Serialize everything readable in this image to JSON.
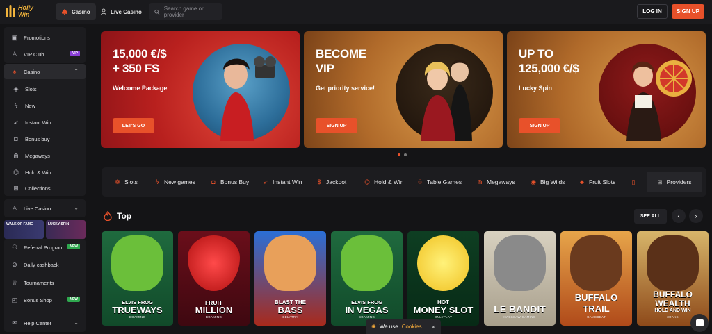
{
  "header": {
    "logo_text_1": "Holly",
    "logo_text_2": "Win",
    "tabs": [
      {
        "label": "Casino",
        "icon": "spade-icon"
      },
      {
        "label": "Live Casino",
        "icon": "dealer-icon"
      }
    ],
    "search_placeholder": "Search game or provider",
    "login_label": "LOG IN",
    "signup_label": "SIGN UP"
  },
  "sidebar": {
    "promotions": "Promotions",
    "vip_club": "VIP Club",
    "vip_badge": "VIP",
    "casino": "Casino",
    "casino_items": [
      "Slots",
      "New",
      "Instant Win",
      "Bonus buy",
      "Megaways",
      "Hold & Win",
      "Collections"
    ],
    "live_casino": "Live Casino",
    "promo_tiles": [
      "WALK OF FAME",
      "LUCKY SPIN"
    ],
    "referral": "Referral Program",
    "referral_badge": "NEW",
    "daily_cashback": "Daily cashback",
    "tournaments": "Tournaments",
    "bonus_shop": "Bonus Shop",
    "bonus_shop_badge": "NEW",
    "help_center": "Help Center"
  },
  "banners": [
    {
      "title_1": "15,000 €/$",
      "title_2": "+ 350 FS",
      "subtitle": "Welcome Package",
      "cta": "LET'S GO"
    },
    {
      "title_1": "BECOME",
      "title_2": "VIP",
      "subtitle": "Get priority service!",
      "cta": "SIGN UP"
    },
    {
      "title_1": "UP TO",
      "title_2": "125,000 €/$",
      "subtitle": "Lucky Spin",
      "cta": "SIGN UP"
    }
  ],
  "categories": [
    "Slots",
    "New games",
    "Bonus Buy",
    "Instant Win",
    "Jackpot",
    "Hold & Win",
    "Table Games",
    "Megaways",
    "Big Wilds",
    "Fruit Slots"
  ],
  "providers_label": "Providers",
  "top_section": {
    "title": "Top",
    "see_all": "SEE ALL"
  },
  "games": [
    {
      "line1": "ELVIS FROG",
      "line2": "TRUEWAYS",
      "provider": "BGAMING"
    },
    {
      "line1": "FRUIT",
      "line2": "MILLION",
      "provider": "BGAMING"
    },
    {
      "line1": "BLAST THE",
      "line2": "BASS",
      "provider": "BELATRA"
    },
    {
      "line1": "ELVIS FROG",
      "line2": "IN VEGAS",
      "provider": "BGAMING"
    },
    {
      "line1": "HOT",
      "line2": "MONEY SLOT",
      "provider": "ONLYPLAY"
    },
    {
      "line1": "",
      "line2": "LE BANDIT",
      "provider": "HACKSAW GAMING"
    },
    {
      "line1": "BUFFALO",
      "line2": "TRAIL",
      "provider": "GAMEBEAT"
    },
    {
      "line1": "BUFFALO",
      "line2": "WEALTH",
      "line3": "HOLD AND WIN",
      "provider": "3OAKS"
    }
  ],
  "cookie": {
    "text": "We use",
    "link": "Cookies",
    "close": "×"
  },
  "colors": {
    "accent": "#e8512a",
    "background": "#141416"
  }
}
